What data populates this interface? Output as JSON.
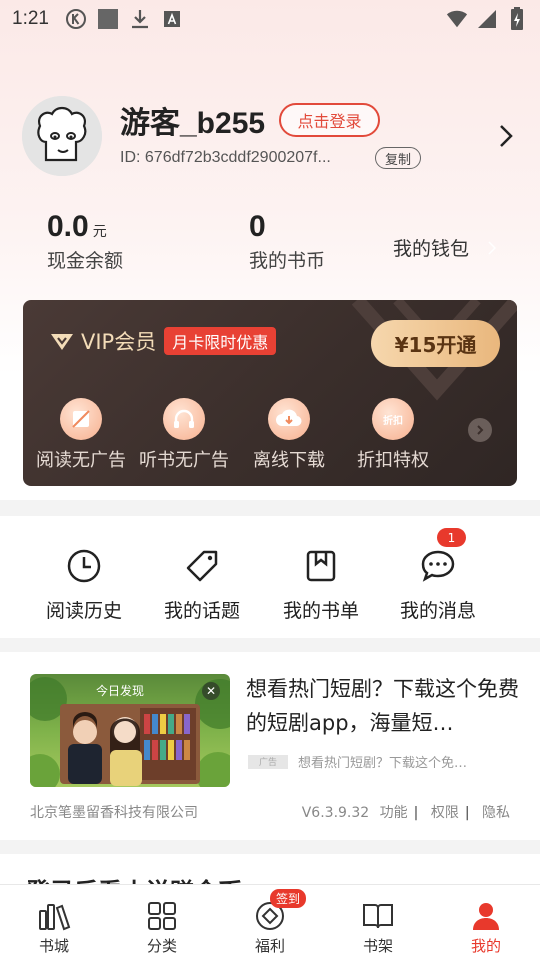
{
  "status_bar": {
    "time": "1:21",
    "left_icons": [
      "k-circle-icon",
      "square-icon",
      "download-icon",
      "a-box-icon"
    ],
    "right_icons": [
      "wifi-icon",
      "signal-icon",
      "battery-icon"
    ]
  },
  "profile": {
    "username": "游客_b255",
    "login_label": "点击登录",
    "user_id": "ID: 676df72b3cddf2900207f...",
    "copy_label": "复制"
  },
  "stats": {
    "cash_value": "0.0",
    "cash_unit": "元",
    "cash_label": "现金余额",
    "coins_value": "0",
    "coins_label": "我的书币",
    "wallet_label": "我的钱包"
  },
  "vip": {
    "title": "VIP会员",
    "badge": "月卡限时优惠",
    "button": "¥15开通",
    "benefits": [
      {
        "label": "阅读无广告",
        "icon": "no-ads-icon"
      },
      {
        "label": "听书无广告",
        "icon": "headphones-icon"
      },
      {
        "label": "离线下载",
        "icon": "cloud-download-icon"
      },
      {
        "label": "折扣特权",
        "icon": "discount-icon"
      }
    ],
    "discount_icon_text": "折扣"
  },
  "quick_actions": [
    {
      "label": "阅读历史",
      "icon": "clock-icon"
    },
    {
      "label": "我的话题",
      "icon": "tag-icon"
    },
    {
      "label": "我的书单",
      "icon": "bookmark-icon"
    },
    {
      "label": "我的消息",
      "icon": "message-icon"
    }
  ],
  "message_badge": "1",
  "ad": {
    "image_tag": "今日发现",
    "title": "想看热门短剧？下载这个免费的短剧app，海量短…",
    "source_logo": "广告",
    "source_text": "想看热门短剧？下载这个免…",
    "company": "北京笔墨留香科技有限公司",
    "version": "V6.3.9.32",
    "links": [
      "功能",
      "权限",
      "隐私"
    ]
  },
  "peek_text": "登录后看小说赚金币",
  "bottom_nav": [
    {
      "label": "书城",
      "icon": "bookstore-icon"
    },
    {
      "label": "分类",
      "icon": "grid-icon"
    },
    {
      "label": "福利",
      "icon": "welfare-icon",
      "badge": "签到"
    },
    {
      "label": "书架",
      "icon": "book-icon"
    },
    {
      "label": "我的",
      "icon": "user-icon",
      "active": true
    }
  ],
  "colors": {
    "accent_red": "#e8392c",
    "vip_gold": "#f3dcb8",
    "vip_bg": "#3a2e2b"
  }
}
